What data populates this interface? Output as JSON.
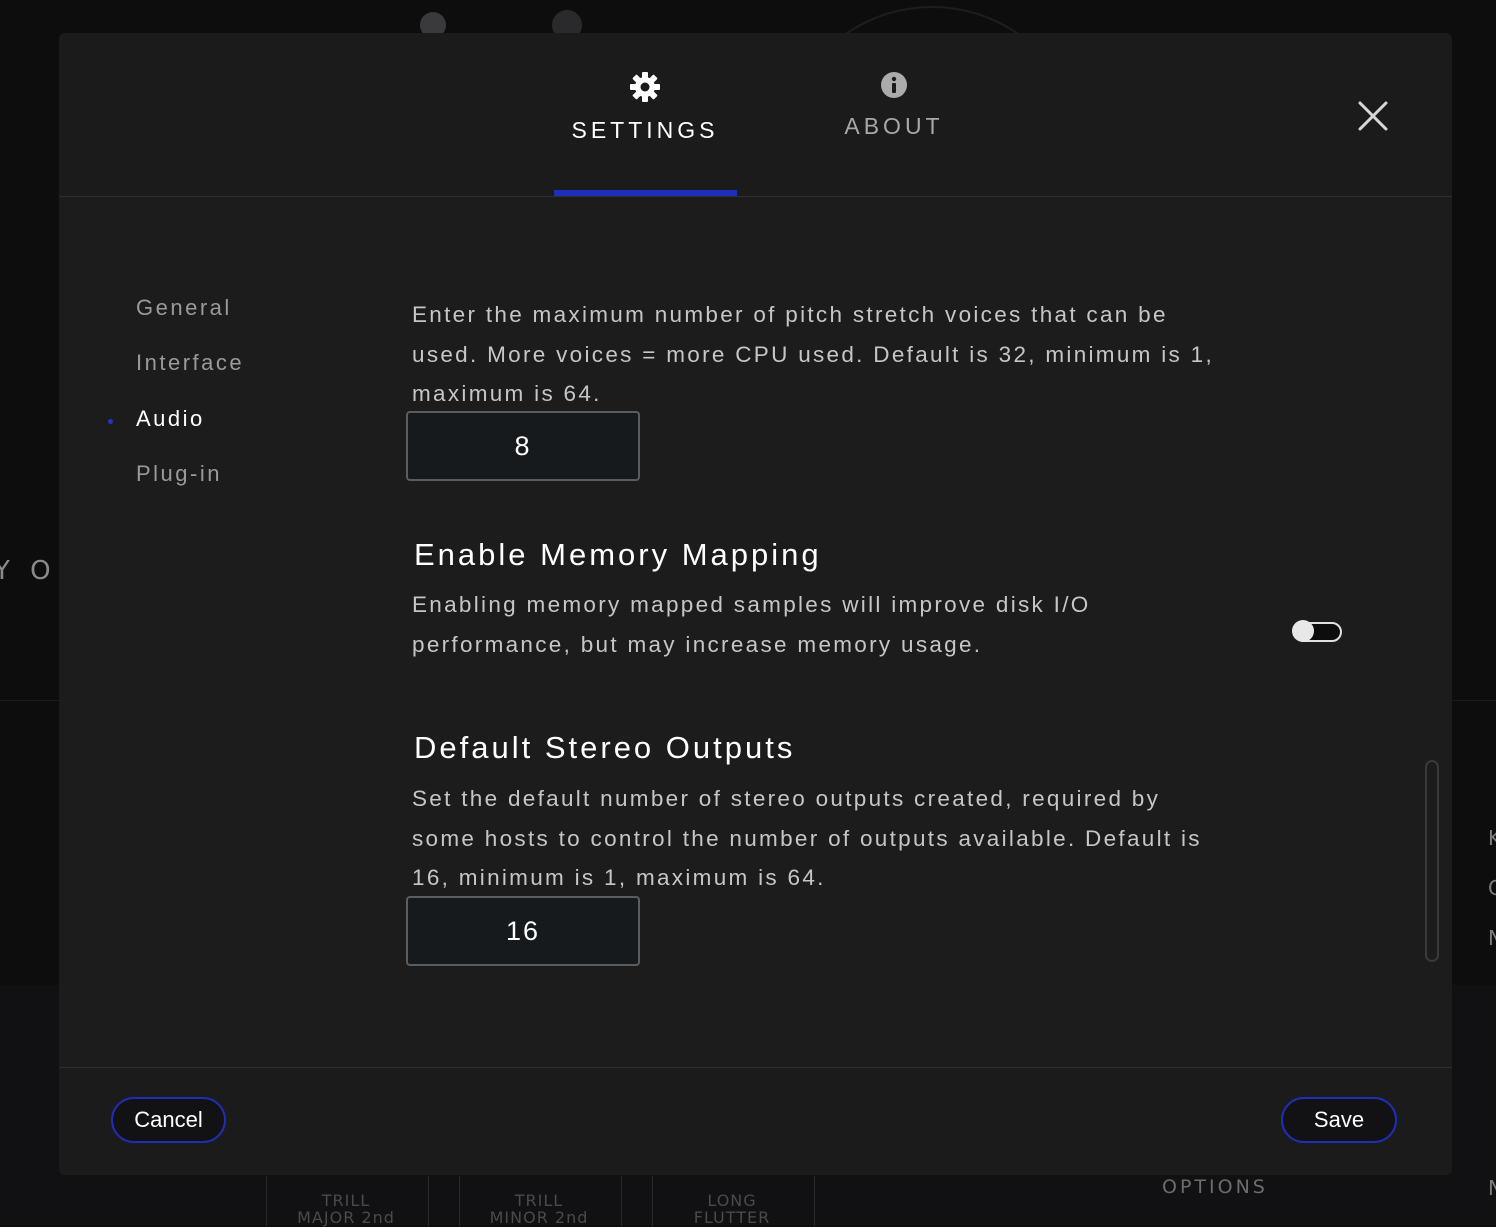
{
  "background": {
    "left_text": "Y OF",
    "options_label": "OPTIONS",
    "bottom_labels": [
      {
        "line1": "TRILL",
        "line2": "MAJOR 2nd"
      },
      {
        "line1": "TRILL",
        "line2": "MINOR 2nd"
      },
      {
        "line1": "LONG",
        "line2": "FLUTTER"
      }
    ],
    "right_letters": [
      "K",
      "C",
      "N",
      "N"
    ]
  },
  "tabs": [
    {
      "label": "SETTINGS",
      "icon": "gear-icon",
      "active": true
    },
    {
      "label": "ABOUT",
      "icon": "info-icon",
      "active": false
    }
  ],
  "sidebar": {
    "items": [
      {
        "label": "General"
      },
      {
        "label": "Interface"
      },
      {
        "label": "Audio"
      },
      {
        "label": "Plug-in"
      }
    ],
    "active": "Audio"
  },
  "audio": {
    "pitch_stretch": {
      "description_lines": [
        "Enter the maximum number of pitch stretch voices that can be",
        "used. More voices = more CPU used. Default is 32, minimum is 1,",
        "maximum is 64."
      ],
      "value": "8"
    },
    "memory_mapping": {
      "title": "Enable Memory Mapping",
      "description_lines": [
        "Enabling memory mapped samples will improve disk I/O",
        "performance, but may increase memory usage."
      ],
      "enabled": false
    },
    "stereo_outputs": {
      "title": "Default Stereo Outputs",
      "description_lines": [
        "Set the default number of stereo outputs created, required by",
        "some hosts to control the number of outputs available. Default is",
        "16, minimum is 1, maximum is 64."
      ],
      "value": "16"
    }
  },
  "footer": {
    "cancel_label": "Cancel",
    "save_label": "Save"
  },
  "colors": {
    "accent": "#1d2fb8",
    "panel": "#1c1c1d",
    "text": "#ffffff",
    "muted": "#9a9a9a"
  }
}
